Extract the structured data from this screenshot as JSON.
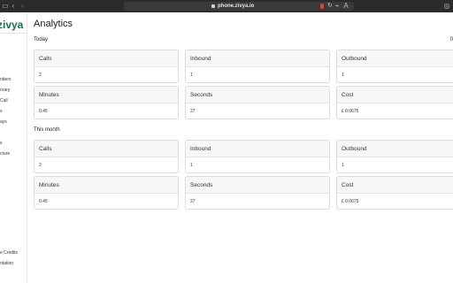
{
  "browser": {
    "url": "phone.zivya.io",
    "nav_back": "‹",
    "nav_forward": "›",
    "reload": "↻",
    "reader_label": "A"
  },
  "sidebar": {
    "brand": "zivya",
    "items": [
      {
        "label": "nbers"
      },
      {
        "label": "orary"
      },
      {
        "label": "Call"
      },
      {
        "label": "s"
      },
      {
        "label": "ays"
      },
      {
        "label": "s"
      },
      {
        "label": "cture"
      },
      {
        "label": "e Credits"
      },
      {
        "label": "ntation"
      }
    ]
  },
  "page": {
    "title": "Analytics",
    "corner_text": "0"
  },
  "sections": [
    {
      "title": "Today",
      "cards": [
        {
          "label": "Calls",
          "value": "2"
        },
        {
          "label": "Inbound",
          "value": "1"
        },
        {
          "label": "Outbound",
          "value": "1"
        },
        {
          "label": "Minutes",
          "value": "0.45"
        },
        {
          "label": "Seconds",
          "value": "27"
        },
        {
          "label": "Cost",
          "value": "£ 0.0675"
        }
      ]
    },
    {
      "title": "This month",
      "cards": [
        {
          "label": "Calls",
          "value": "2"
        },
        {
          "label": "Inbound",
          "value": "1"
        },
        {
          "label": "Outbound",
          "value": "1"
        },
        {
          "label": "Minutes",
          "value": "0.45"
        },
        {
          "label": "Seconds",
          "value": "27"
        },
        {
          "label": "Cost",
          "value": "£ 0.0675"
        }
      ]
    }
  ]
}
